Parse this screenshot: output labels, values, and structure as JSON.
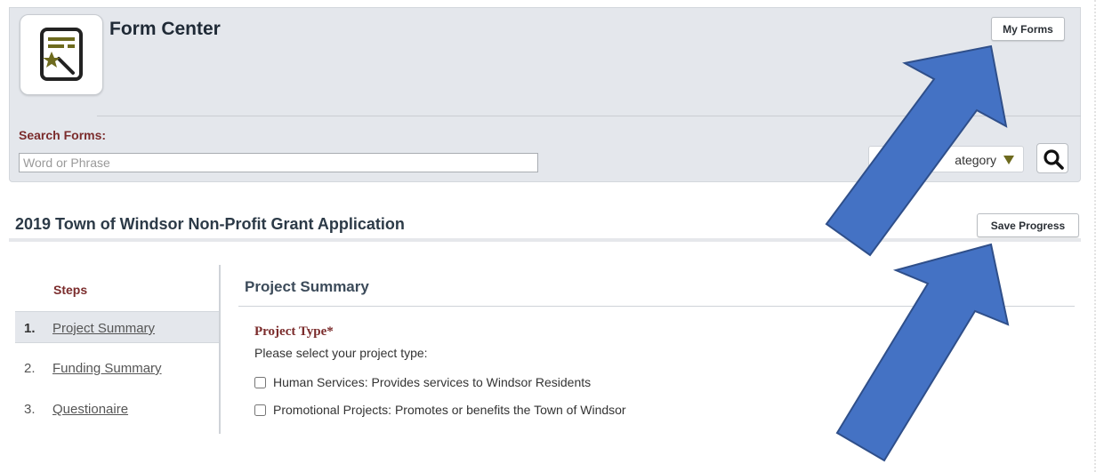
{
  "header": {
    "title": "Form Center",
    "my_forms_label": "My Forms",
    "logo_icon": "form-wand-icon"
  },
  "search": {
    "label": "Search Forms:",
    "placeholder": "Word or Phrase",
    "category_label": "ategory",
    "search_icon": "search-icon"
  },
  "form": {
    "title": "2019 Town of Windsor Non-Profit Grant Application",
    "save_label": "Save Progress"
  },
  "steps": {
    "heading": "Steps",
    "items": [
      {
        "num": "1.",
        "label": "Project Summary",
        "active": true
      },
      {
        "num": "2.",
        "label": "Funding Summary",
        "active": false
      },
      {
        "num": "3.",
        "label": "Questionaire",
        "active": false
      }
    ]
  },
  "section": {
    "title": "Project Summary",
    "field_label": "Project Type*",
    "field_hint": "Please select your project type:",
    "options": [
      "Human Services: Provides services to Windsor Residents",
      "Promotional Projects: Promotes or benefits the Town of Windsor"
    ]
  },
  "colors": {
    "panel": "#e4e7ec",
    "label_maroon": "#7b2c2c",
    "arrow_blue": "#4472c4",
    "icon_olive": "#6d6a1e"
  }
}
